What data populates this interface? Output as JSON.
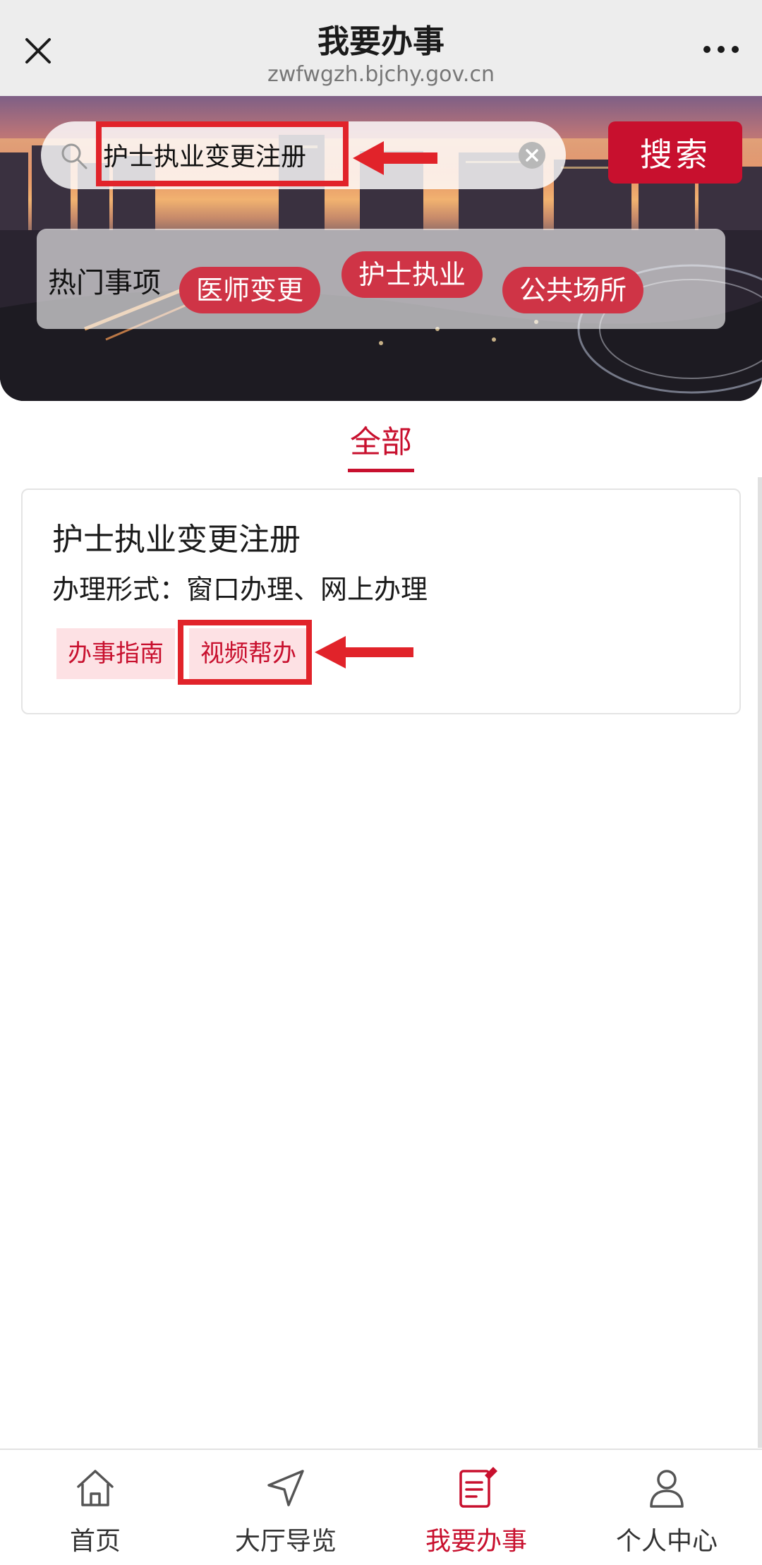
{
  "header": {
    "title": "我要办事",
    "url": "zwfwgzh.bjchy.gov.cn"
  },
  "search": {
    "query": "护士执业变更注册",
    "button_label": "搜索"
  },
  "hot": {
    "label": "热门事项",
    "tags": [
      "医师变更",
      "护士执业",
      "公共场所"
    ]
  },
  "tabs": [
    {
      "label": "全部",
      "active": true
    }
  ],
  "results": [
    {
      "title": "护士执业变更注册",
      "method": "办理形式：窗口办理、网上办理",
      "actions": [
        "办事指南",
        "视频帮办"
      ]
    }
  ],
  "bottom_nav": [
    {
      "label": "首页",
      "icon": "home-icon",
      "active": false
    },
    {
      "label": "大厅导览",
      "icon": "navigation-arrow-icon",
      "active": false
    },
    {
      "label": "我要办事",
      "icon": "document-edit-icon",
      "active": true
    },
    {
      "label": "个人中心",
      "icon": "user-icon",
      "active": false
    }
  ],
  "colors": {
    "accent": "#c8102e",
    "annotation": "#e1232a",
    "chip_bg": "#fde1e4",
    "topbar_bg": "#ededed"
  }
}
